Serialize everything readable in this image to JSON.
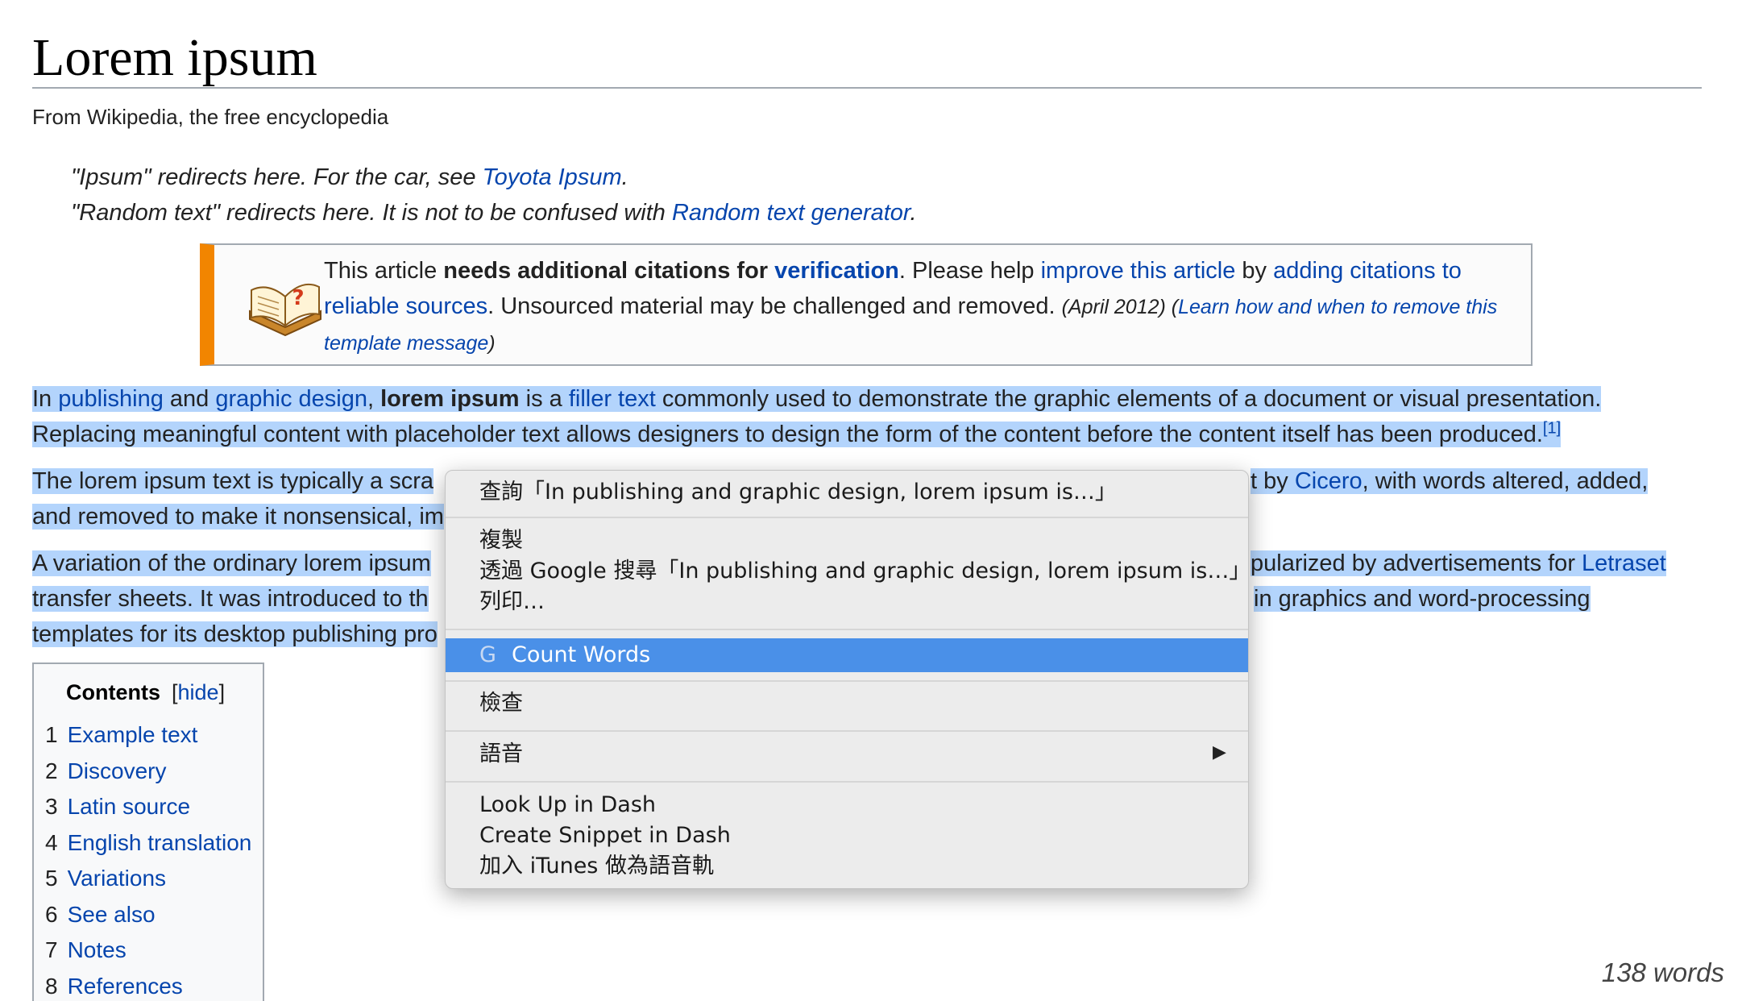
{
  "article": {
    "title": "Lorem ipsum",
    "subtitle": "From Wikipedia, the free encyclopedia",
    "hatnote1": {
      "prefix": "\"Ipsum\" redirects here. For the car, see ",
      "link": "Toyota Ipsum",
      "suffix": "."
    },
    "hatnote2": {
      "prefix": "\"Random text\" redirects here. It is not to be confused with ",
      "link": "Random text generator",
      "suffix": "."
    }
  },
  "ambox": {
    "t1": "This article ",
    "bold": "needs additional citations for ",
    "link_verification": "verification",
    "t2": ". Please help ",
    "link_improve": "improve this article",
    "t3": " by ",
    "link_adding": "adding citations to reliable sources",
    "t4": ". Unsourced material may be challenged and removed. ",
    "date": "(April 2012)",
    "learn_open": " (",
    "link_learn": "Learn how and when to remove this template message",
    "learn_close": ")"
  },
  "para1": {
    "t1": "In ",
    "link_publishing": "publishing",
    "t2": " and ",
    "link_graphic": "graphic design",
    "t3": ", ",
    "bold": "lorem ipsum",
    "t4": " is a ",
    "link_filler": "filler text",
    "t5": " commonly used to demonstrate the graphic elements of a document or visual presentation.",
    "line2": "Replacing meaningful content with placeholder text allows designers to design the form of the content before the content itself has been produced.",
    "ref": "[1]"
  },
  "para2": {
    "l1_left": "The lorem ipsum text is typically a scra",
    "l1_right_a": "t by ",
    "l1_link": "Cicero",
    "l1_right_b": ", with words altered, added,",
    "l2_left": "and removed to make it nonsensical, im"
  },
  "para3": {
    "l1_left": "A variation of the ordinary lorem ipsum",
    "l1_right_a": "pularized by advertisements for ",
    "l1_link": "Letraset",
    "l2_left": "transfer sheets. It was introduced to th",
    "l2_right": "in graphics and word-processing",
    "l3_left": "templates for its desktop publishing pro"
  },
  "toc": {
    "heading": "Contents",
    "hide": "hide",
    "items": [
      {
        "num": "1",
        "label": "Example text"
      },
      {
        "num": "2",
        "label": "Discovery"
      },
      {
        "num": "3",
        "label": "Latin source"
      },
      {
        "num": "4",
        "label": "English translation"
      },
      {
        "num": "5",
        "label": "Variations"
      },
      {
        "num": "6",
        "label": "See also"
      },
      {
        "num": "7",
        "label": "Notes"
      },
      {
        "num": "8",
        "label": "References"
      }
    ]
  },
  "context_menu": {
    "lookup": "查詢「In publishing and graphic design, lorem ipsum is…」",
    "copy": "複製",
    "google_search": "透過 Google 搜尋「In publishing and graphic design, lorem ipsum is…」",
    "print": "列印…",
    "count_words_icon": "G",
    "count_words": "Count Words",
    "inspect": "檢查",
    "speech": "語音",
    "speech_arrow": "▶",
    "lookup_dash": "Look Up in Dash",
    "snippet_dash": "Create Snippet in Dash",
    "itunes": "加入 iTunes 做為語音軌"
  },
  "status": {
    "word_count": "138 words"
  },
  "colors": {
    "link": "#0645ad",
    "selection": "#b3d4fc",
    "menu_highlight": "#4a90e8",
    "ambox_stripe": "#f28500"
  },
  "icons": {
    "ambox": "open-book-question-icon",
    "count_words": "grammarly-icon",
    "submenu": "submenu-arrow-icon"
  }
}
